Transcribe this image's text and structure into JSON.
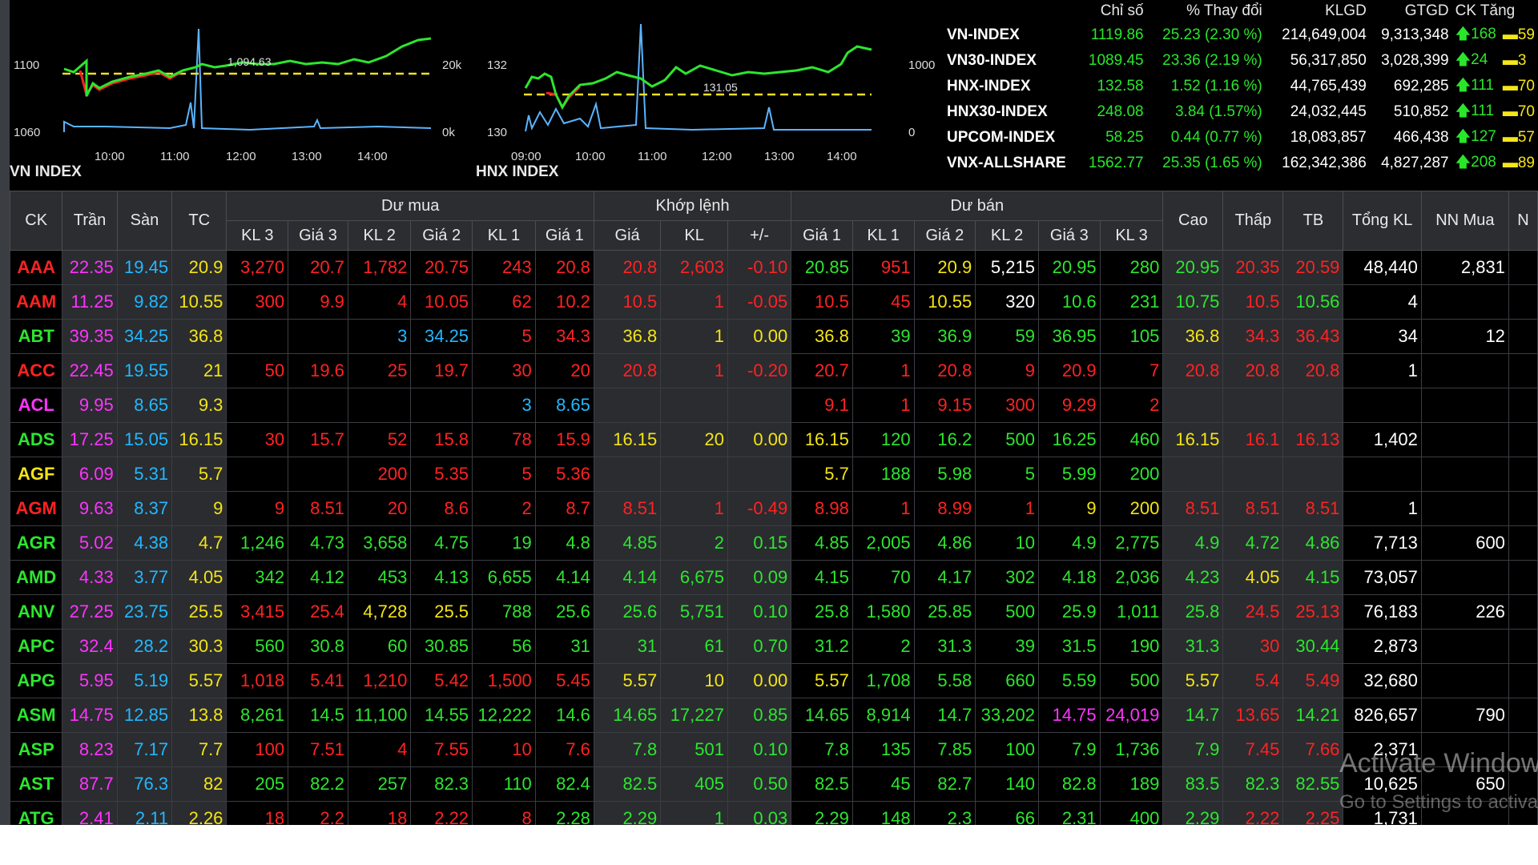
{
  "colors": {
    "up": "#2ce62e",
    "down": "#ff2222",
    "ceiling": "#ff33ff",
    "floor": "#22b8ff",
    "reference": "#f4e414",
    "neutral": "#ffffff",
    "ref_line": "#f0e020",
    "volume": "#5ab4ff"
  },
  "charts": {
    "vn": {
      "title": "VN INDEX",
      "y_labels": [
        "1100",
        "1060"
      ],
      "vol_labels": [
        "20k",
        "0k"
      ],
      "x_labels": [
        "10:00",
        "11:00",
        "12:00",
        "13:00",
        "14:00"
      ],
      "ref_label": "1,094.63"
    },
    "hnx": {
      "title": "HNX INDEX",
      "y_labels": [
        "132",
        "130"
      ],
      "vol_labels": [
        "1000",
        "0"
      ],
      "x_labels": [
        "09:00",
        "10:00",
        "11:00",
        "12:00",
        "13:00",
        "14:00"
      ],
      "ref_label": "131.05"
    }
  },
  "index_table": {
    "headers": [
      "Chỉ số",
      "% Thay đổi",
      "KLGD",
      "GTGD",
      "CK Tăng"
    ],
    "rows": [
      {
        "name": "VN-INDEX",
        "value": "1119.86",
        "change": "25.23 (2.30 %)",
        "volume": "214,649,004",
        "gtgd": "9,313,348",
        "up": "168",
        "ref": "59"
      },
      {
        "name": "VN30-INDEX",
        "value": "1089.45",
        "change": "23.36 (2.19 %)",
        "volume": "56,317,850",
        "gtgd": "3,028,399",
        "up": "24",
        "ref": "3"
      },
      {
        "name": "HNX-INDEX",
        "value": "132.58",
        "change": "1.52 (1.16 %)",
        "volume": "44,765,439",
        "gtgd": "692,285",
        "up": "111",
        "ref": "70"
      },
      {
        "name": "HNX30-INDEX",
        "value": "248.08",
        "change": "3.84 (1.57%)",
        "volume": "24,032,445",
        "gtgd": "510,852",
        "up": "111",
        "ref": "70"
      },
      {
        "name": "UPCOM-INDEX",
        "value": "58.25",
        "change": "0.44 (0.77 %)",
        "volume": "18,083,857",
        "gtgd": "466,438",
        "up": "127",
        "ref": "57"
      },
      {
        "name": "VNX-ALLSHARE",
        "value": "1562.77",
        "change": "25.35 (1.65 %)",
        "volume": "162,342,386",
        "gtgd": "4,827,287",
        "up": "208",
        "ref": "89"
      }
    ]
  },
  "board": {
    "group_headers": {
      "buy": "Dư mua",
      "match": "Khớp lệnh",
      "sell": "Dư bán"
    },
    "headers": [
      "CK",
      "Trần",
      "Sàn",
      "TC",
      "KL 3",
      "Giá 3",
      "KL 2",
      "Giá 2",
      "KL 1",
      "Giá 1",
      "Giá",
      "KL",
      "+/-",
      "Giá 1",
      "KL 1",
      "Giá 2",
      "KL 2",
      "Giá 3",
      "KL 3",
      "Cao",
      "Thấp",
      "TB",
      "Tổng KL",
      "NN Mua",
      "N"
    ],
    "rows": [
      {
        "sym": "AAA",
        "cells": [
          "22.35",
          "19.45",
          "20.9",
          "3,270",
          "20.7",
          "1,782",
          "20.75",
          "243",
          "20.8",
          "20.8",
          "2,603",
          "-0.10",
          "20.85",
          "951",
          "20.9",
          "5,215",
          "20.95",
          "280",
          "20.95",
          "20.35",
          "20.59",
          "48,440",
          "2,831",
          ""
        ],
        "colors": [
          "ce",
          "fl",
          "rf",
          "d",
          "d",
          "d",
          "d",
          "d",
          "d",
          "d",
          "d",
          "d",
          "u",
          "d",
          "rf",
          "w",
          "u",
          "u",
          "u",
          "d",
          "d",
          "w",
          "w",
          "w"
        ]
      },
      {
        "sym": "AAM",
        "cells": [
          "11.25",
          "9.82",
          "10.55",
          "300",
          "9.9",
          "4",
          "10.05",
          "62",
          "10.2",
          "10.5",
          "1",
          "-0.05",
          "10.5",
          "45",
          "10.55",
          "320",
          "10.6",
          "231",
          "10.75",
          "10.5",
          "10.56",
          "4",
          "",
          ""
        ],
        "colors": [
          "ce",
          "fl",
          "rf",
          "d",
          "d",
          "d",
          "d",
          "d",
          "d",
          "d",
          "d",
          "d",
          "d",
          "d",
          "rf",
          "w",
          "u",
          "u",
          "u",
          "d",
          "u",
          "w",
          "w",
          "w"
        ]
      },
      {
        "sym": "ABT",
        "cells": [
          "39.35",
          "34.25",
          "36.8",
          "",
          "",
          "3",
          "34.25",
          "5",
          "34.3",
          "36.8",
          "1",
          "0.00",
          "36.8",
          "39",
          "36.9",
          "59",
          "36.95",
          "105",
          "36.8",
          "34.3",
          "36.43",
          "34",
          "12",
          ""
        ],
        "colors": [
          "ce",
          "fl",
          "rf",
          "w",
          "w",
          "fl",
          "fl",
          "d",
          "d",
          "rf",
          "rf",
          "rf",
          "rf",
          "u",
          "u",
          "u",
          "u",
          "u",
          "rf",
          "d",
          "d",
          "w",
          "w",
          "w"
        ]
      },
      {
        "sym": "ACC",
        "cells": [
          "22.45",
          "19.55",
          "21",
          "50",
          "19.6",
          "25",
          "19.7",
          "30",
          "20",
          "20.8",
          "1",
          "-0.20",
          "20.7",
          "1",
          "20.8",
          "9",
          "20.9",
          "7",
          "20.8",
          "20.8",
          "20.8",
          "1",
          "",
          ""
        ],
        "colors": [
          "ce",
          "fl",
          "rf",
          "d",
          "d",
          "d",
          "d",
          "d",
          "d",
          "d",
          "d",
          "d",
          "d",
          "d",
          "d",
          "d",
          "d",
          "d",
          "d",
          "d",
          "d",
          "w",
          "w",
          "w"
        ]
      },
      {
        "sym": "ACL",
        "cells": [
          "9.95",
          "8.65",
          "9.3",
          "",
          "",
          "",
          "",
          "3",
          "8.65",
          "",
          "",
          "",
          "9.1",
          "1",
          "9.15",
          "300",
          "9.29",
          "2",
          "",
          "",
          "",
          "",
          "",
          ""
        ],
        "colors": [
          "ce",
          "fl",
          "rf",
          "w",
          "w",
          "w",
          "w",
          "fl",
          "fl",
          "w",
          "w",
          "w",
          "d",
          "d",
          "d",
          "d",
          "d",
          "d",
          "w",
          "w",
          "w",
          "w",
          "w",
          "w"
        ]
      },
      {
        "sym": "ADS",
        "cells": [
          "17.25",
          "15.05",
          "16.15",
          "30",
          "15.7",
          "52",
          "15.8",
          "78",
          "15.9",
          "16.15",
          "20",
          "0.00",
          "16.15",
          "120",
          "16.2",
          "500",
          "16.25",
          "460",
          "16.15",
          "16.1",
          "16.13",
          "1,402",
          "",
          ""
        ],
        "colors": [
          "ce",
          "fl",
          "rf",
          "d",
          "d",
          "d",
          "d",
          "d",
          "d",
          "rf",
          "rf",
          "rf",
          "rf",
          "u",
          "u",
          "u",
          "u",
          "u",
          "rf",
          "d",
          "d",
          "w",
          "w",
          "w"
        ]
      },
      {
        "sym": "AGF",
        "cells": [
          "6.09",
          "5.31",
          "5.7",
          "",
          "",
          "200",
          "5.35",
          "5",
          "5.36",
          "",
          "",
          "",
          "5.7",
          "188",
          "5.98",
          "5",
          "5.99",
          "200",
          "",
          "",
          "",
          "",
          "",
          ""
        ],
        "colors": [
          "ce",
          "fl",
          "rf",
          "w",
          "w",
          "d",
          "d",
          "d",
          "d",
          "w",
          "w",
          "w",
          "rf",
          "u",
          "u",
          "u",
          "u",
          "u",
          "w",
          "w",
          "w",
          "w",
          "w",
          "w"
        ]
      },
      {
        "sym": "AGM",
        "cells": [
          "9.63",
          "8.37",
          "9",
          "9",
          "8.51",
          "20",
          "8.6",
          "2",
          "8.7",
          "8.51",
          "1",
          "-0.49",
          "8.98",
          "1",
          "8.99",
          "1",
          "9",
          "200",
          "8.51",
          "8.51",
          "8.51",
          "1",
          "",
          ""
        ],
        "colors": [
          "ce",
          "fl",
          "rf",
          "d",
          "d",
          "d",
          "d",
          "d",
          "d",
          "d",
          "d",
          "d",
          "d",
          "d",
          "d",
          "d",
          "rf",
          "rf",
          "d",
          "d",
          "d",
          "w",
          "w",
          "w"
        ]
      },
      {
        "sym": "AGR",
        "cells": [
          "5.02",
          "4.38",
          "4.7",
          "1,246",
          "4.73",
          "3,658",
          "4.75",
          "19",
          "4.8",
          "4.85",
          "2",
          "0.15",
          "4.85",
          "2,005",
          "4.86",
          "10",
          "4.9",
          "2,775",
          "4.9",
          "4.72",
          "4.86",
          "7,713",
          "600",
          ""
        ],
        "colors": [
          "ce",
          "fl",
          "rf",
          "u",
          "u",
          "u",
          "u",
          "u",
          "u",
          "u",
          "u",
          "u",
          "u",
          "u",
          "u",
          "u",
          "u",
          "u",
          "u",
          "u",
          "u",
          "w",
          "w",
          "w"
        ]
      },
      {
        "sym": "AMD",
        "cells": [
          "4.33",
          "3.77",
          "4.05",
          "342",
          "4.12",
          "453",
          "4.13",
          "6,655",
          "4.14",
          "4.14",
          "6,675",
          "0.09",
          "4.15",
          "70",
          "4.17",
          "302",
          "4.18",
          "2,036",
          "4.23",
          "4.05",
          "4.15",
          "73,057",
          "",
          ""
        ],
        "colors": [
          "ce",
          "fl",
          "rf",
          "u",
          "u",
          "u",
          "u",
          "u",
          "u",
          "u",
          "u",
          "u",
          "u",
          "u",
          "u",
          "u",
          "u",
          "u",
          "u",
          "rf",
          "u",
          "w",
          "w",
          "w"
        ]
      },
      {
        "sym": "ANV",
        "cells": [
          "27.25",
          "23.75",
          "25.5",
          "3,415",
          "25.4",
          "4,728",
          "25.5",
          "788",
          "25.6",
          "25.6",
          "5,751",
          "0.10",
          "25.8",
          "1,580",
          "25.85",
          "500",
          "25.9",
          "1,011",
          "25.8",
          "24.5",
          "25.13",
          "76,183",
          "226",
          ""
        ],
        "colors": [
          "ce",
          "fl",
          "rf",
          "d",
          "d",
          "rf",
          "rf",
          "u",
          "u",
          "u",
          "u",
          "u",
          "u",
          "u",
          "u",
          "u",
          "u",
          "u",
          "u",
          "d",
          "d",
          "w",
          "w",
          "w"
        ]
      },
      {
        "sym": "APC",
        "cells": [
          "32.4",
          "28.2",
          "30.3",
          "560",
          "30.8",
          "60",
          "30.85",
          "56",
          "31",
          "31",
          "61",
          "0.70",
          "31.2",
          "2",
          "31.3",
          "39",
          "31.5",
          "190",
          "31.3",
          "30",
          "30.44",
          "2,873",
          "",
          ""
        ],
        "colors": [
          "ce",
          "fl",
          "rf",
          "u",
          "u",
          "u",
          "u",
          "u",
          "u",
          "u",
          "u",
          "u",
          "u",
          "u",
          "u",
          "u",
          "u",
          "u",
          "u",
          "d",
          "u",
          "w",
          "w",
          "w"
        ]
      },
      {
        "sym": "APG",
        "cells": [
          "5.95",
          "5.19",
          "5.57",
          "1,018",
          "5.41",
          "1,210",
          "5.42",
          "1,500",
          "5.45",
          "5.57",
          "10",
          "0.00",
          "5.57",
          "1,708",
          "5.58",
          "660",
          "5.59",
          "500",
          "5.57",
          "5.4",
          "5.49",
          "32,680",
          "",
          ""
        ],
        "colors": [
          "ce",
          "fl",
          "rf",
          "d",
          "d",
          "d",
          "d",
          "d",
          "d",
          "rf",
          "rf",
          "rf",
          "rf",
          "u",
          "u",
          "u",
          "u",
          "u",
          "rf",
          "d",
          "d",
          "w",
          "w",
          "w"
        ]
      },
      {
        "sym": "ASM",
        "cells": [
          "14.75",
          "12.85",
          "13.8",
          "8,261",
          "14.5",
          "11,100",
          "14.55",
          "12,222",
          "14.6",
          "14.65",
          "17,227",
          "0.85",
          "14.65",
          "8,914",
          "14.7",
          "33,202",
          "14.75",
          "24,019",
          "14.7",
          "13.65",
          "14.21",
          "826,657",
          "790",
          ""
        ],
        "colors": [
          "ce",
          "fl",
          "rf",
          "u",
          "u",
          "u",
          "u",
          "u",
          "u",
          "u",
          "u",
          "u",
          "u",
          "u",
          "u",
          "u",
          "ce",
          "ce",
          "u",
          "d",
          "u",
          "w",
          "w",
          "w"
        ]
      },
      {
        "sym": "ASP",
        "cells": [
          "8.23",
          "7.17",
          "7.7",
          "100",
          "7.51",
          "4",
          "7.55",
          "10",
          "7.6",
          "7.8",
          "501",
          "0.10",
          "7.8",
          "135",
          "7.85",
          "100",
          "7.9",
          "1,736",
          "7.9",
          "7.45",
          "7.66",
          "2,371",
          "",
          ""
        ],
        "colors": [
          "ce",
          "fl",
          "rf",
          "d",
          "d",
          "d",
          "d",
          "d",
          "d",
          "u",
          "u",
          "u",
          "u",
          "u",
          "u",
          "u",
          "u",
          "u",
          "u",
          "d",
          "d",
          "w",
          "w",
          "w"
        ]
      },
      {
        "sym": "AST",
        "cells": [
          "87.7",
          "76.3",
          "82",
          "205",
          "82.2",
          "257",
          "82.3",
          "110",
          "82.4",
          "82.5",
          "405",
          "0.50",
          "82.5",
          "45",
          "82.7",
          "140",
          "82.8",
          "189",
          "83.5",
          "82.3",
          "82.55",
          "10,625",
          "650",
          ""
        ],
        "colors": [
          "ce",
          "fl",
          "rf",
          "u",
          "u",
          "u",
          "u",
          "u",
          "u",
          "u",
          "u",
          "u",
          "u",
          "u",
          "u",
          "u",
          "u",
          "u",
          "u",
          "u",
          "u",
          "w",
          "w",
          "w"
        ]
      },
      {
        "sym": "ATG",
        "cells": [
          "2.41",
          "2.11",
          "2.26",
          "18",
          "2.2",
          "18",
          "2.22",
          "8",
          "2.28",
          "2.29",
          "1",
          "0.03",
          "2.29",
          "148",
          "2.3",
          "66",
          "2.31",
          "400",
          "2.29",
          "2.22",
          "2.25",
          "1,731",
          "",
          ""
        ],
        "colors": [
          "ce",
          "fl",
          "rf",
          "d",
          "d",
          "d",
          "d",
          "d",
          "u",
          "u",
          "u",
          "u",
          "u",
          "u",
          "u",
          "u",
          "u",
          "u",
          "u",
          "d",
          "d",
          "w",
          "w",
          "w"
        ]
      }
    ],
    "sym_colors": [
      "d",
      "d",
      "u",
      "d",
      "ce",
      "u",
      "rf",
      "d",
      "u",
      "u",
      "u",
      "u",
      "u",
      "u",
      "u",
      "u",
      "u"
    ]
  },
  "watermark": {
    "line1": "Activate Windows",
    "line2": "Go to Settings to activate Windows."
  }
}
